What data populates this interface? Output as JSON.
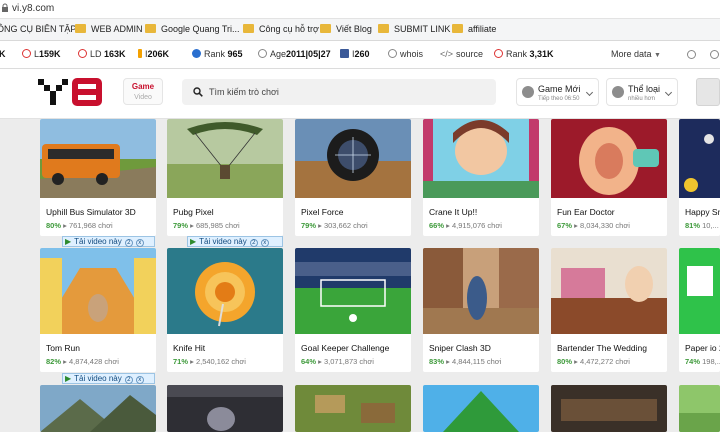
{
  "browser": {
    "url": "vi.y8.com"
  },
  "bookmarks": [
    {
      "label": "ÔNG CỤ BIÊN TẬP...",
      "folder": false
    },
    {
      "label": "WEB ADMIN",
      "folder": true
    },
    {
      "label": "Google Quang Tri...",
      "folder": true
    },
    {
      "label": "Công cụ hỗ trợ",
      "folder": true
    },
    {
      "label": "Viết Blog",
      "folder": true
    },
    {
      "label": "SUBMIT LINK",
      "folder": true
    },
    {
      "label": "affiliate",
      "folder": true
    }
  ],
  "seo_toolbar": {
    "items": [
      {
        "prefix": "",
        "value": "K"
      },
      {
        "prefix": "L",
        "value": "159K"
      },
      {
        "prefix": "LD",
        "value": "163K"
      },
      {
        "prefix": "I",
        "value": "206K"
      },
      {
        "prefix": "Rank",
        "value": "965"
      },
      {
        "prefix": "Age",
        "value": "2011|05|27"
      },
      {
        "prefix": "I",
        "value": "260"
      },
      {
        "prefix": "",
        "value": "whois"
      },
      {
        "prefix": "",
        "value": "source"
      },
      {
        "prefix": "Rank",
        "value": "3,31K"
      }
    ],
    "more": "More data"
  },
  "header": {
    "game_tab": "Game",
    "video_tab": "Video",
    "search_placeholder": "Tìm kiếm trò chơi",
    "new_games": {
      "label": "Game Mới",
      "sub": "Tiếp theo 06:50"
    },
    "genres": {
      "label": "Thể loại",
      "sub": "nhiều hơn"
    }
  },
  "video_bar": {
    "label": "Tải video này",
    "controls": [
      "2",
      "x"
    ]
  },
  "rows": [
    {
      "games": [
        {
          "title": "Uphill Bus Simulator 3D",
          "rating": "80%",
          "plays": "761,968 chơi"
        },
        {
          "title": "Pubg Pixel",
          "rating": "79%",
          "plays": "685,985 chơi"
        },
        {
          "title": "Pixel Force",
          "rating": "79%",
          "plays": "303,662 chơi"
        },
        {
          "title": "Crane It Up!!",
          "rating": "66%",
          "plays": "4,915,076 chơi"
        },
        {
          "title": "Fun Ear Doctor",
          "rating": "67%",
          "plays": "8,034,330 chơi"
        },
        {
          "title": "Happy Sn",
          "rating": "81%",
          "plays": "10,..."
        }
      ]
    },
    {
      "games": [
        {
          "title": "Tom Run",
          "rating": "82%",
          "plays": "4,874,428 chơi"
        },
        {
          "title": "Knife Hit",
          "rating": "71%",
          "plays": "2,540,162 chơi"
        },
        {
          "title": "Goal Keeper Challenge",
          "rating": "64%",
          "plays": "3,071,873 chơi"
        },
        {
          "title": "Sniper Clash 3D",
          "rating": "83%",
          "plays": "4,844,115 chơi"
        },
        {
          "title": "Bartender The Wedding",
          "rating": "80%",
          "plays": "4,472,272 chơi"
        },
        {
          "title": "Paper io 2",
          "rating": "74%",
          "plays": "198,..."
        }
      ]
    },
    {
      "games": [
        {},
        {},
        {},
        {},
        {},
        {}
      ]
    }
  ],
  "colors": {
    "brand": "#c8102e",
    "rating": "#3e9a3b"
  }
}
